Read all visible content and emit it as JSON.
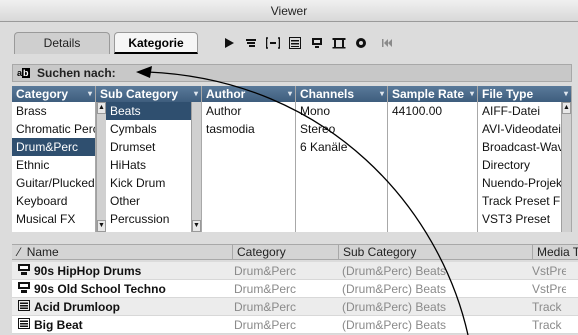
{
  "window": {
    "title": "Viewer"
  },
  "tabs": {
    "details": "Details",
    "kategorie": "Kategorie"
  },
  "toolbar_icons": [
    "play-icon",
    "filter-icon",
    "bracket-icon",
    "list-icon",
    "loop-icon",
    "columns-icon",
    "cog-icon",
    "rewind-icon"
  ],
  "search": {
    "label": "Suchen nach:",
    "icon_a": "a",
    "icon_b": "b"
  },
  "filters": {
    "category": {
      "header": "Category",
      "items": [
        "Brass",
        "Chromatic Perc",
        "Drum&Perc",
        "Ethnic",
        "Guitar/Plucked",
        "Keyboard",
        "Musical FX"
      ],
      "selected": 2
    },
    "subcategory": {
      "header": "Sub Category",
      "items": [
        "Beats",
        "Cymbals",
        "Drumset",
        "HiHats",
        "Kick Drum",
        "Other",
        "Percussion"
      ],
      "selected": 0
    },
    "author": {
      "header": "Author",
      "items": [
        "Author",
        "tasmodia"
      ]
    },
    "channels": {
      "header": "Channels",
      "items": [
        "Mono",
        "Stereo",
        "6 Kanäle"
      ]
    },
    "samplerate": {
      "header": "Sample Rate",
      "items": [
        "44100.00"
      ]
    },
    "filetype": {
      "header": "File Type",
      "items": [
        "AIFF-Datei",
        "AVI-Videodatei",
        "Broadcast-Wav",
        "Directory",
        "Nuendo-Projek",
        "Track Preset Fi",
        "VST3 Preset"
      ]
    }
  },
  "results": {
    "columns": {
      "name": "Name",
      "category": "Category",
      "subcategory": "Sub Category",
      "media": "Media T"
    },
    "rows": [
      {
        "name": "90s HipHop Drums",
        "category": "Drum&Perc",
        "subcategory": "(Drum&Perc) Beats",
        "media": "VstPre",
        "icon": "instrument-icon"
      },
      {
        "name": "90s Old School Techno",
        "category": "Drum&Perc",
        "subcategory": "(Drum&Perc) Beats",
        "media": "VstPre",
        "icon": "instrument-icon"
      },
      {
        "name": "Acid Drumloop",
        "category": "Drum&Perc",
        "subcategory": "(Drum&Perc) Beats",
        "media": "Track",
        "icon": "track-icon"
      },
      {
        "name": "Big Beat",
        "category": "Drum&Perc",
        "subcategory": "(Drum&Perc) Beats",
        "media": "Track",
        "icon": "track-icon"
      }
    ]
  },
  "colors": {
    "header_blue": "#3e5d7d",
    "selected": "#2f4f6f"
  }
}
